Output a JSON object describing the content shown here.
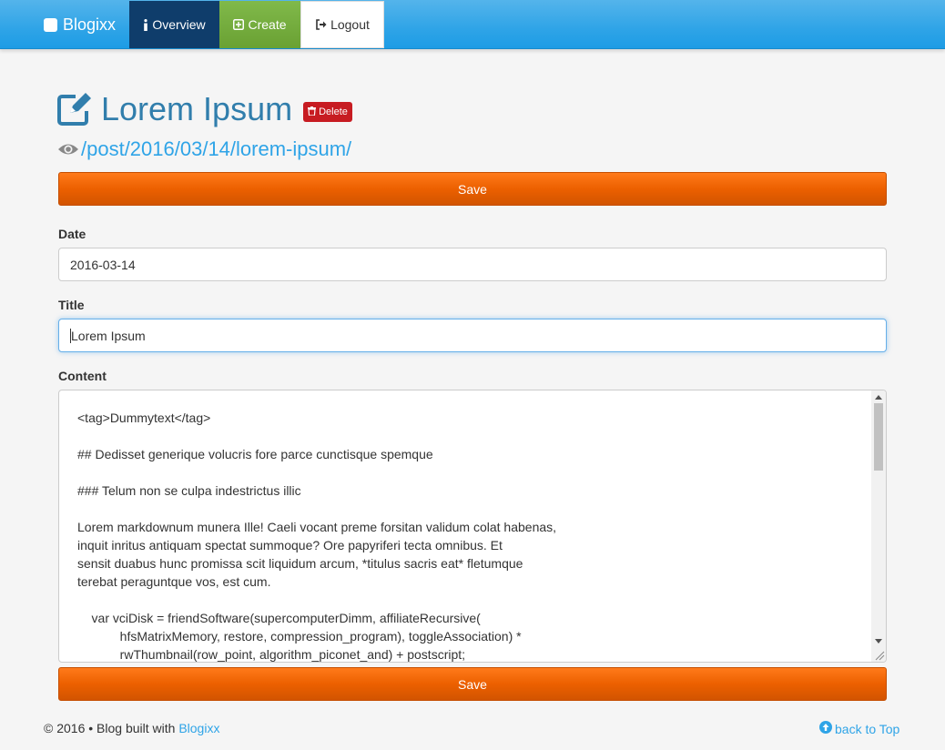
{
  "navbar": {
    "brand": "Blogixx",
    "items": [
      {
        "label": "Overview",
        "icon": "info-icon"
      },
      {
        "label": "Create",
        "icon": "plus-square-icon"
      },
      {
        "label": "Logout",
        "icon": "sign-out-icon"
      }
    ]
  },
  "post": {
    "title": "Lorem Ipsum",
    "delete_label": "Delete",
    "url": "/post/2016/03/14/lorem-ipsum/"
  },
  "form": {
    "save_label": "Save",
    "date_label": "Date",
    "date_value": "2016-03-14",
    "title_label": "Title",
    "title_value": "Lorem Ipsum",
    "content_label": "Content",
    "content_value": "<tag>Dummytext</tag>\n\n## Dedisset generique volucris fore parce cunctisque spemque\n\n### Telum non se culpa indestrictus illic\n\nLorem markdownum munera Ille! Caeli vocant preme forsitan validum colat habenas,\ninquit inritus antiquam spectat summoque? Ore papyriferi tecta omnibus. Et\nsensit duabus hunc promissa scit liquidum arcum, *titulus sacris eat* fletumque\nterebat peraguntque vos, est cum.\n\n    var vciDisk = friendSoftware(supercomputerDimm, affiliateRecursive(\n            hfsMatrixMemory, restore, compression_program), toggleAssociation) *\n            rwThumbnail(row_point, algorithm_piconet_and) + postscript;"
  },
  "footer": {
    "copyright": "© 2016 • Blog built with",
    "link": "Blogixx",
    "back_to_top": "back to Top"
  },
  "colors": {
    "navbar": "#2fa4e7",
    "overview_active": "#0f3d6b",
    "create": "#73a839",
    "save": "#ec6000",
    "delete": "#c71c22",
    "title": "#317eac",
    "link": "#2fa4e7"
  }
}
